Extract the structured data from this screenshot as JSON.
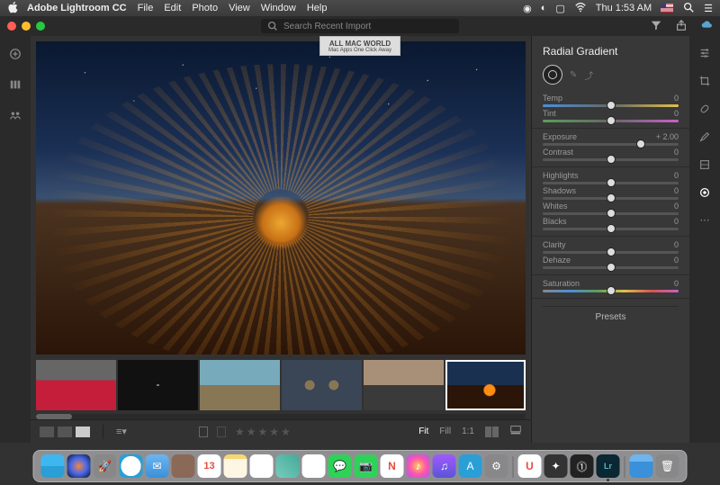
{
  "menubar": {
    "app_name": "Adobe Lightroom CC",
    "items": [
      "File",
      "Edit",
      "Photo",
      "View",
      "Window",
      "Help"
    ],
    "clock": "Thu 1:53 AM"
  },
  "titlebar": {
    "search_placeholder": "Search Recent Import",
    "filter_icon": "filter-icon",
    "share_icon": "share-icon",
    "cloud_icon": "cloud-sync-icon"
  },
  "watermark": {
    "line1": "ALL MAC WORLD",
    "line2": "Mac Apps One Click Away"
  },
  "leftbar": {
    "items": [
      "add-icon",
      "library-icon",
      "people-icon"
    ]
  },
  "rightbar": {
    "items": [
      "sliders-icon",
      "crop-icon",
      "heal-icon",
      "brush-icon",
      "linear-gradient-icon",
      "radial-gradient-icon",
      "more-icon"
    ],
    "active_index": 5
  },
  "panel": {
    "title": "Radial Gradient",
    "mask_tools": [
      "new-mask",
      "brush-mask",
      "invert-mask"
    ],
    "sliders": [
      {
        "label": "Temp",
        "value": "0",
        "pos": 50,
        "track": "temp"
      },
      {
        "label": "Tint",
        "value": "0",
        "pos": 50,
        "track": "tint"
      },
      {
        "label": "Exposure",
        "value": "+ 2.00",
        "pos": 72,
        "track": ""
      },
      {
        "label": "Contrast",
        "value": "0",
        "pos": 50,
        "track": ""
      },
      {
        "label": "Highlights",
        "value": "0",
        "pos": 50,
        "track": ""
      },
      {
        "label": "Shadows",
        "value": "0",
        "pos": 50,
        "track": ""
      },
      {
        "label": "Whites",
        "value": "0",
        "pos": 50,
        "track": ""
      },
      {
        "label": "Blacks",
        "value": "0",
        "pos": 50,
        "track": ""
      },
      {
        "label": "Clarity",
        "value": "0",
        "pos": 50,
        "track": ""
      },
      {
        "label": "Dehaze",
        "value": "0",
        "pos": 50,
        "track": ""
      },
      {
        "label": "Saturation",
        "value": "0",
        "pos": 50,
        "track": "sat"
      }
    ],
    "sep_after": [
      1,
      3,
      7,
      9,
      10
    ],
    "presets_label": "Presets"
  },
  "filmstrip": {
    "thumbs": [
      "sports-car",
      "apple-logo",
      "mountain-landscape",
      "coffee-cups",
      "canyon-sunset",
      "steel-wool-spin"
    ],
    "active_index": 5
  },
  "bottombar": {
    "view_modes": [
      "grid-large",
      "grid-small",
      "single"
    ],
    "view_active": 2,
    "sort_icon": "sort-icon",
    "flags": [
      "flag-picked",
      "flag-rejected"
    ],
    "stars": "★★★★★",
    "fit": "Fit",
    "fill": "Fill",
    "oneone": "1:1",
    "compare_icon": "compare-icon",
    "strip_icon": "toggle-filmstrip-icon"
  },
  "dock": {
    "calendar_day": "13",
    "items": [
      "finder",
      "siri",
      "launchpad",
      "safari",
      "mail",
      "contacts",
      "calendar",
      "notes",
      "reminders",
      "maps",
      "photos",
      "messages",
      "facetime",
      "news",
      "itunes",
      "music",
      "appstore",
      "system-preferences",
      "app-u",
      "final-cut-pro",
      "1password",
      "lightroom",
      "downloads-folder",
      "trash"
    ],
    "lr_label": "Lr"
  }
}
